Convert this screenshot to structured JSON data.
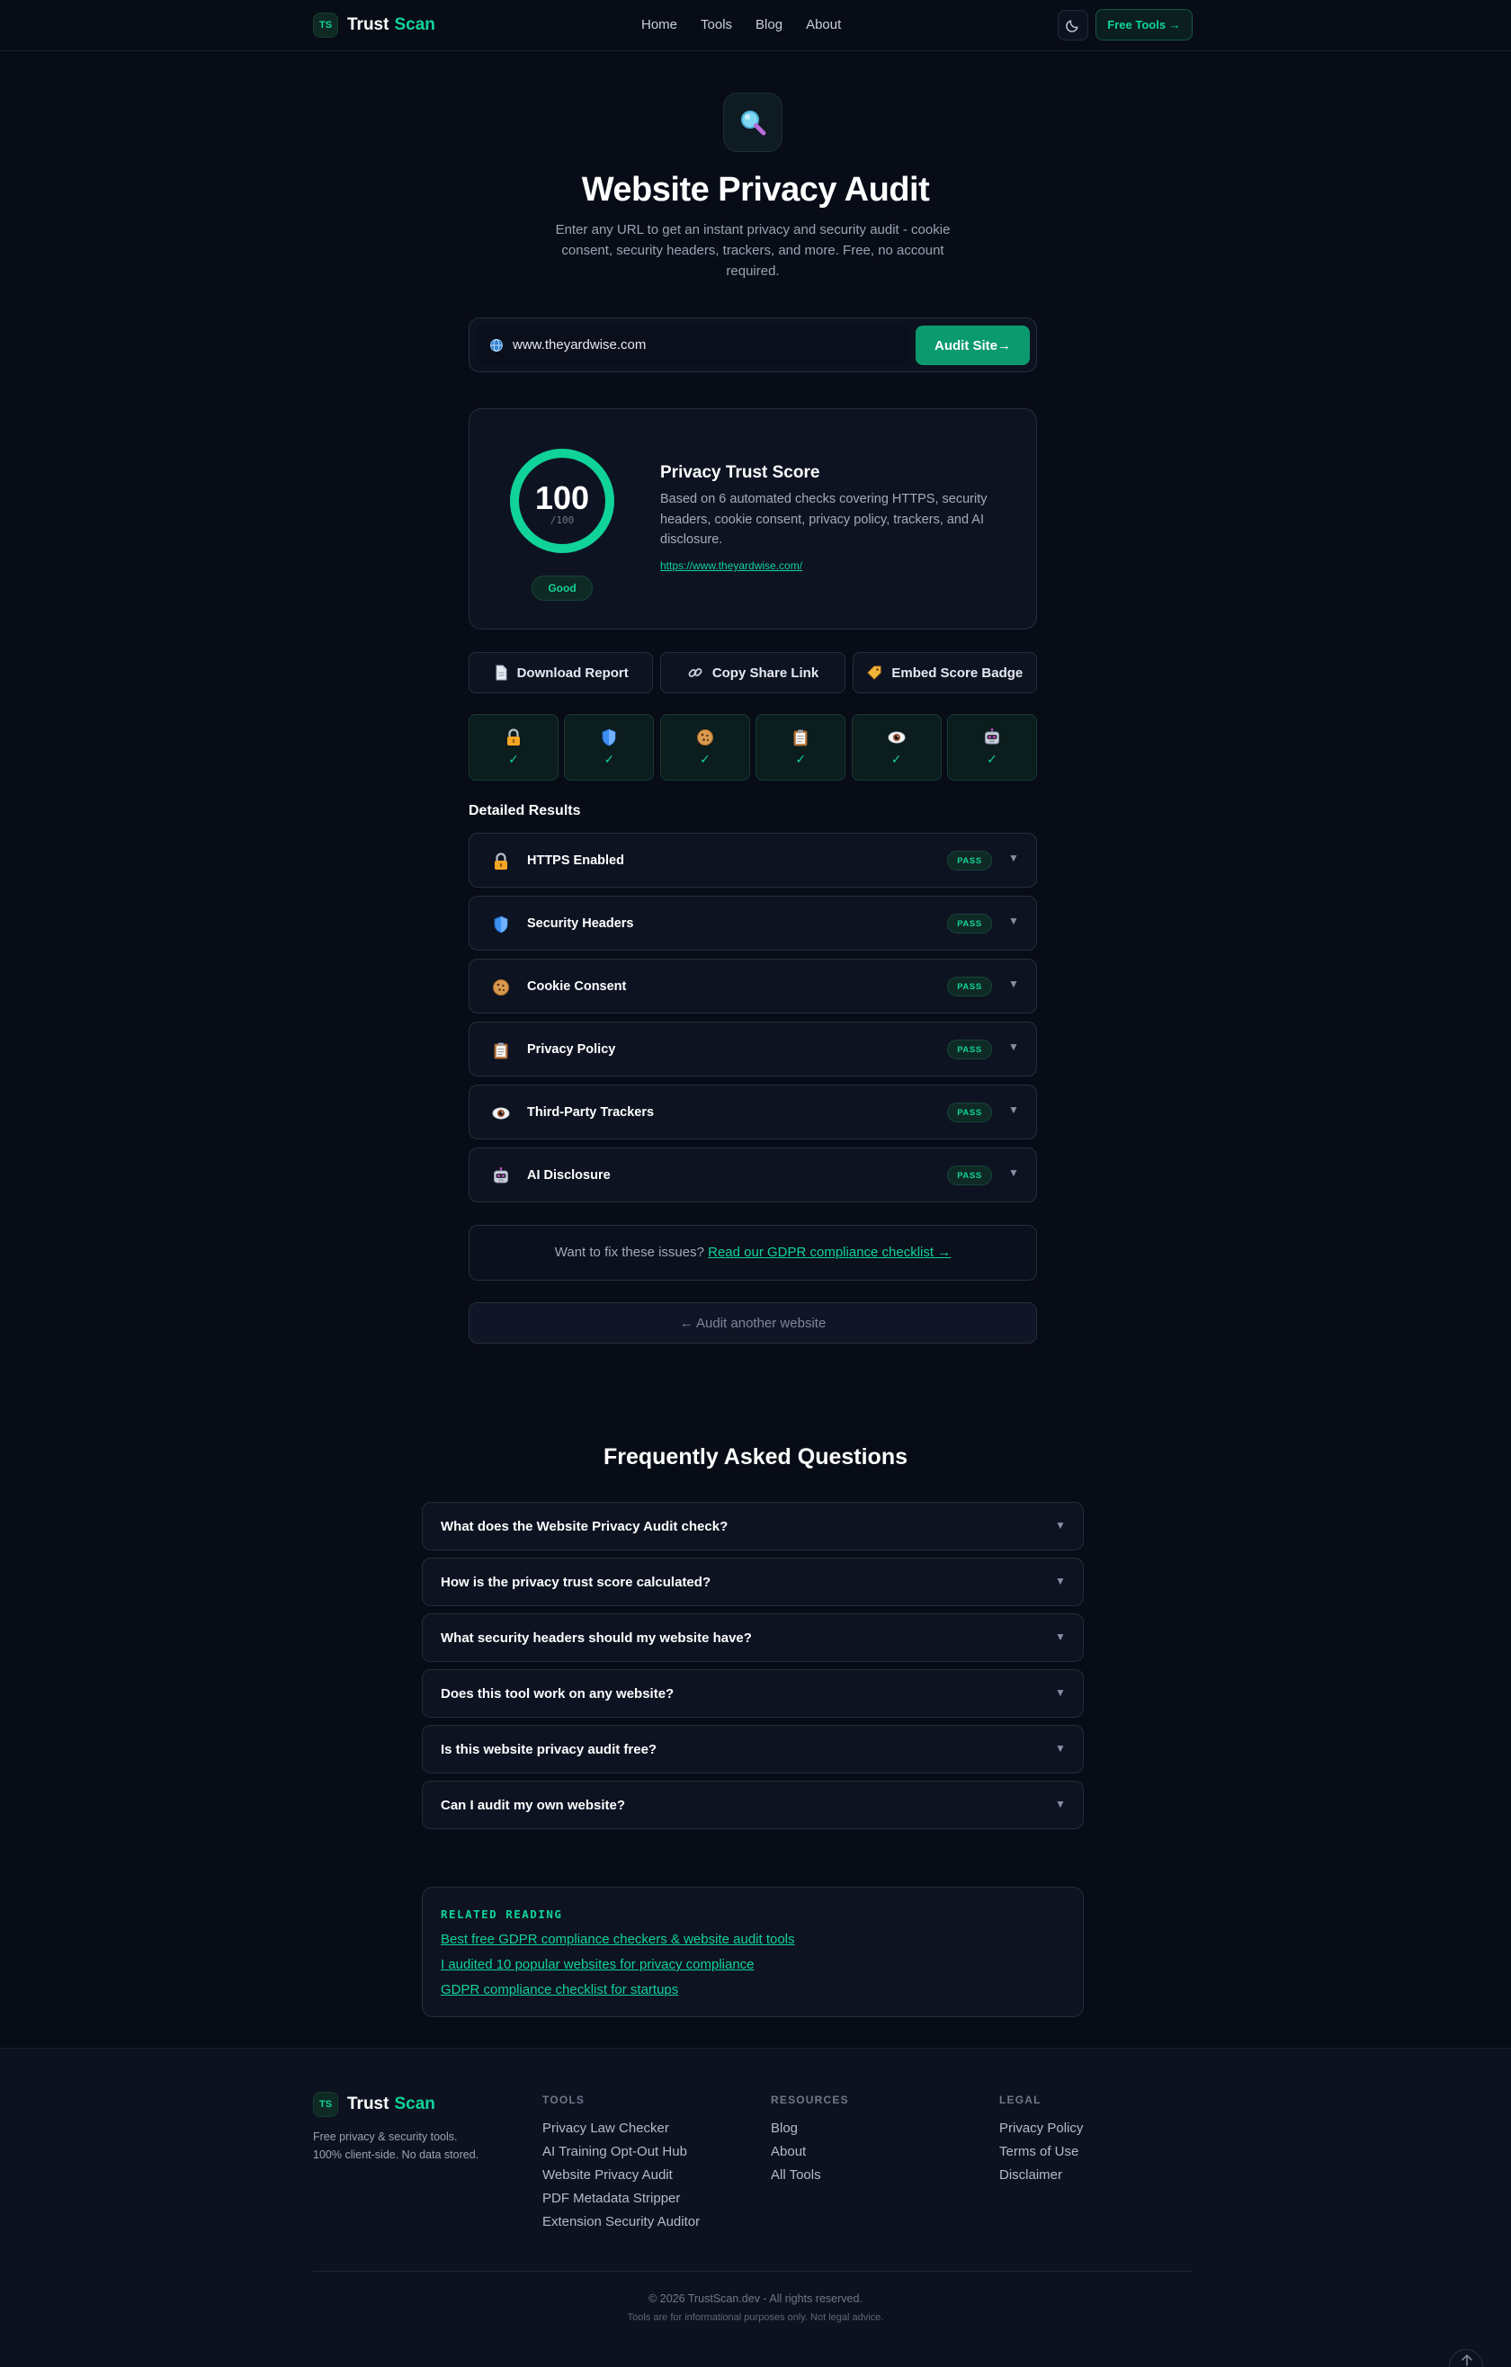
{
  "nav": {
    "logo_mark": "TS",
    "logo_word1": "Trust",
    "logo_word2": "Scan",
    "links": [
      "Home",
      "Tools",
      "Blog",
      "About"
    ],
    "theme_icon": "moon-icon",
    "cta": "Free Tools →"
  },
  "hero": {
    "icon": "magnifier-icon",
    "title": "Website Privacy Audit",
    "subtitle": "Enter any URL to get an instant privacy and security audit - cookie consent, security headers, trackers, and more. Free, no account required."
  },
  "search": {
    "icon": "globe-icon",
    "value": "www.theyardwise.com",
    "button": "Audit Site→"
  },
  "score": {
    "value": "100",
    "max_label": "/100",
    "fraction": 1.0,
    "grade": "Good",
    "title": "Privacy Trust Score",
    "description": "Based on 6 automated checks covering HTTPS, security headers, cookie consent, privacy policy, trackers, and AI disclosure.",
    "url": "https://www.theyardwise.com/",
    "accent": "#10d399"
  },
  "actions": [
    {
      "icon": "document-icon",
      "label": "Download Report"
    },
    {
      "icon": "link-icon",
      "label": "Copy Share Link"
    },
    {
      "icon": "tag-icon",
      "label": "Embed Score Badge"
    }
  ],
  "tiles": [
    {
      "icon": "lock-icon",
      "check": "✓"
    },
    {
      "icon": "shield-icon",
      "check": "✓"
    },
    {
      "icon": "cookie-icon",
      "check": "✓"
    },
    {
      "icon": "clipboard-icon",
      "check": "✓"
    },
    {
      "icon": "eye-icon",
      "check": "✓"
    },
    {
      "icon": "robot-icon",
      "check": "✓"
    }
  ],
  "results": {
    "title": "Detailed Results",
    "items": [
      {
        "icon": "lock-icon",
        "label": "HTTPS Enabled",
        "status": "PASS"
      },
      {
        "icon": "shield-icon",
        "label": "Security Headers",
        "status": "PASS"
      },
      {
        "icon": "cookie-icon",
        "label": "Cookie Consent",
        "status": "PASS"
      },
      {
        "icon": "clipboard-icon",
        "label": "Privacy Policy",
        "status": "PASS"
      },
      {
        "icon": "eye-icon",
        "label": "Third-Party Trackers",
        "status": "PASS"
      },
      {
        "icon": "robot-icon",
        "label": "AI Disclosure",
        "status": "PASS"
      }
    ]
  },
  "gdpr": {
    "text": "Want to fix these issues?",
    "link": "Read our GDPR compliance checklist →"
  },
  "another": "← Audit another website",
  "faq": {
    "title": "Frequently Asked Questions",
    "items": [
      "What does the Website Privacy Audit check?",
      "How is the privacy trust score calculated?",
      "What security headers should my website have?",
      "Does this tool work on any website?",
      "Is this website privacy audit free?",
      "Can I audit my own website?"
    ]
  },
  "related": {
    "title": "RELATED READING",
    "links": [
      "Best free GDPR compliance checkers & website audit tools",
      "I audited 10 popular websites for privacy compliance",
      "GDPR compliance checklist for startups"
    ]
  },
  "footer": {
    "tagline_1": "Free privacy & security tools.",
    "tagline_2": "100% client-side. No data stored.",
    "columns": [
      {
        "title": "TOOLS",
        "links": [
          "Privacy Law Checker",
          "AI Training Opt-Out Hub",
          "Website Privacy Audit",
          "PDF Metadata Stripper",
          "Extension Security Auditor"
        ]
      },
      {
        "title": "RESOURCES",
        "links": [
          "Blog",
          "About",
          "All Tools"
        ]
      },
      {
        "title": "LEGAL",
        "links": [
          "Privacy Policy",
          "Terms of Use",
          "Disclaimer"
        ]
      }
    ],
    "copyright": "© 2026 TrustScan.dev - All rights reserved.",
    "disclaimer": "Tools are for informational purposes only. Not legal advice.",
    "to_top_icon": "arrow-up-icon"
  }
}
